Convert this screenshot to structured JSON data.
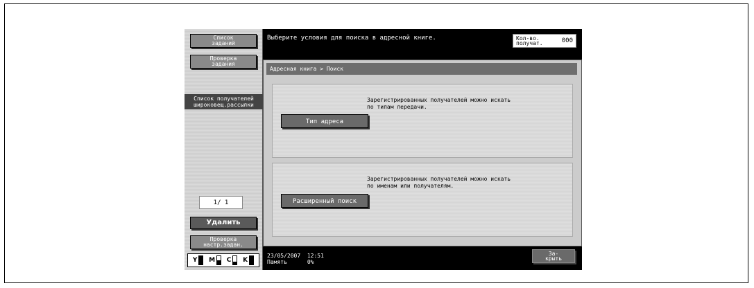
{
  "left_panel": {
    "job_list_label": "Список\nзаданий",
    "job_check_label": "Проверка\nзадания",
    "broadcast_list_label": "Список получателей\nшироковещ.рассылки",
    "page_indicator": "1/  1",
    "delete_label": "Удалить",
    "check_settings_label": "Проверка\nнастр.задан.",
    "toner": [
      {
        "letter": "Y",
        "level": "full"
      },
      {
        "letter": "M",
        "level": "half"
      },
      {
        "letter": "C",
        "level": "low"
      },
      {
        "letter": "K",
        "level": "full"
      }
    ]
  },
  "header": {
    "prompt": "Выберите условия  для поиска в адресной книге.",
    "counter_label": "Кол-во.\nполучат.",
    "counter_value": "000"
  },
  "main": {
    "breadcrumb": "Адресная книга >  Поиск",
    "sections": [
      {
        "description": "Зарегистрированных получателей можно искать\nпо типам передачи.",
        "button": "Тип адреса"
      },
      {
        "description": "Зарегистрированных получателей можно искать\n по именам или получателям.",
        "button": "Расширенный поиск"
      }
    ]
  },
  "footer": {
    "date": "23/05/2007",
    "time": "12:51",
    "memory_label": "Память",
    "memory_value": "0%",
    "close_label": "За-\nкрыть"
  }
}
